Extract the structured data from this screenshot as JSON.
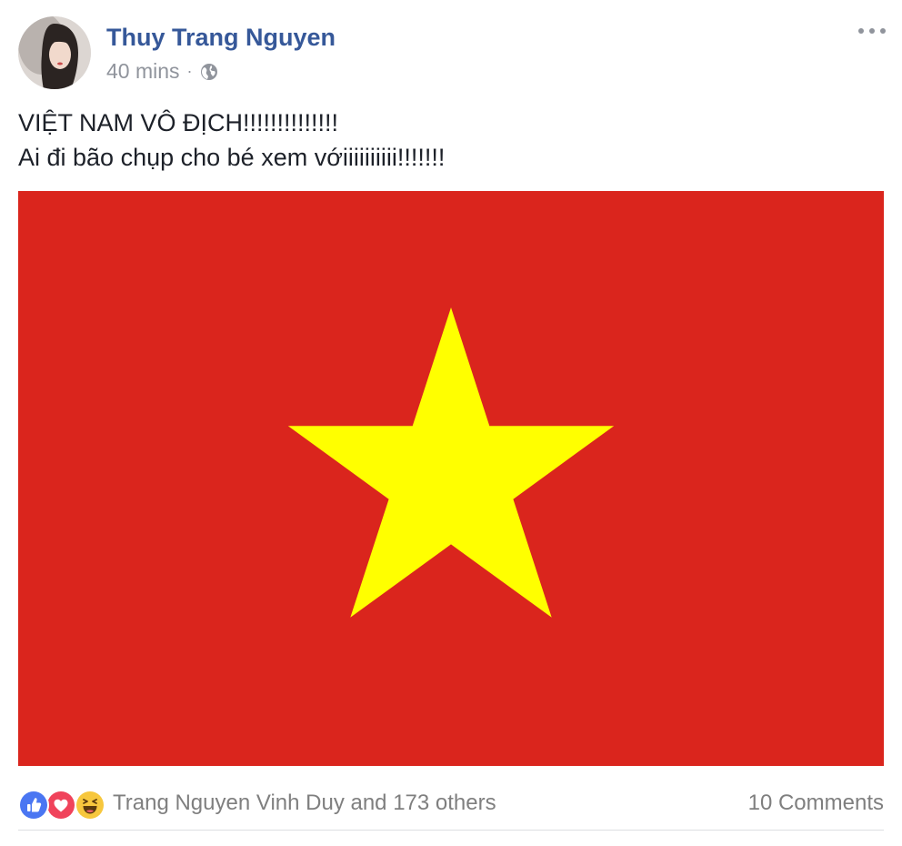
{
  "post": {
    "author": "Thuy Trang Nguyen",
    "timestamp": "40 mins",
    "separator": "·",
    "privacy_icon": "globe-icon",
    "menu_icon": "more-options-icon",
    "text_lines": [
      "VIỆT NAM VÔ ĐỊCH!!!!!!!!!!!!!!",
      "Ai đi bão chụp cho bé xem vớiiiiiiiiii!!!!!!!"
    ],
    "photo": {
      "icon": "vietnam-flag-image",
      "colors": {
        "field": "#da251d",
        "star": "#ffff00"
      }
    }
  },
  "footer": {
    "reaction_icons": [
      "like-icon",
      "love-icon",
      "haha-icon"
    ],
    "reactions_text": "Trang Nguyen Vinh Duy and 173 others",
    "comments_text": "10 Comments"
  },
  "colors": {
    "author_link": "#365899",
    "meta_text": "#90949c",
    "body_text": "#1d2129",
    "like": "#4a76f2",
    "love": "#f0435b",
    "haha": "#f7c73d"
  }
}
